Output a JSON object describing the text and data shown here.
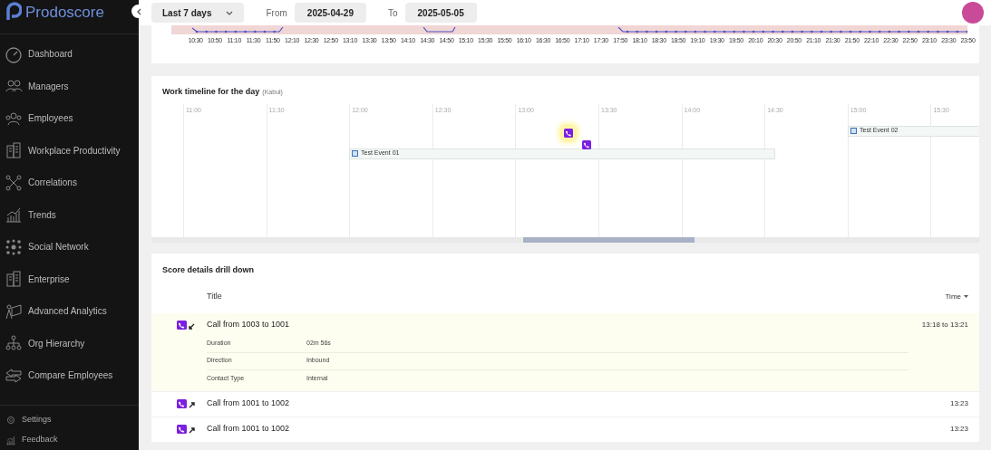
{
  "sidebar": {
    "logo": "Prodoscore",
    "items": [
      {
        "label": "Dashboard"
      },
      {
        "label": "Managers"
      },
      {
        "label": "Employees"
      },
      {
        "label": "Workplace Productivity"
      },
      {
        "label": "Correlations"
      },
      {
        "label": "Trends"
      },
      {
        "label": "Social Network"
      },
      {
        "label": "Enterprise"
      },
      {
        "label": "Advanced Analytics"
      },
      {
        "label": "Org Hierarchy"
      },
      {
        "label": "Compare Employees"
      }
    ],
    "footer": [
      {
        "label": "Settings"
      },
      {
        "label": "Feedback"
      }
    ]
  },
  "toolbar": {
    "range": "Last 7 days",
    "from_label": "From",
    "from": "2025-04-29",
    "to_label": "To",
    "to": "2025-05-05"
  },
  "activity_strip": {
    "labels": [
      "10:30",
      "10:50",
      "11:10",
      "11:30",
      "11:50",
      "12:10",
      "12:30",
      "12:50",
      "13:10",
      "13:30",
      "13:50",
      "14:10",
      "14:30",
      "14:50",
      "15:10",
      "15:30",
      "15:50",
      "16:10",
      "16:30",
      "16:50",
      "17:10",
      "17:30",
      "17:50",
      "18:10",
      "18:30",
      "18:50",
      "19:10",
      "19:30",
      "19:50",
      "20:10",
      "20:30",
      "20:50",
      "21:10",
      "21:30",
      "21:50",
      "22:10",
      "22:30",
      "22:50",
      "23:10",
      "23:30",
      "23:50"
    ]
  },
  "timeline": {
    "title": "Work timeline for the day",
    "timezone": "(Kabul)",
    "hours": [
      "11:00",
      "11:30",
      "12:00",
      "12:30",
      "13:00",
      "13:30",
      "14:00",
      "14:30",
      "15:00",
      "15:30"
    ],
    "events": [
      {
        "label": "Test Event 02"
      },
      {
        "label": "Test Event 01"
      }
    ],
    "calls": [
      {
        "selected": true
      },
      {
        "selected": false
      }
    ]
  },
  "drilldown": {
    "title": "Score details drill down",
    "columns": [
      "Title",
      "Time"
    ],
    "rows": [
      {
        "title": "Call from 1003 to 1001",
        "time": "13:18 to 13:21",
        "kind": "inbound",
        "expanded": true,
        "details": [
          {
            "label": "Duration",
            "value": "02m 56s"
          },
          {
            "label": "Direction",
            "value": "Inbound"
          },
          {
            "label": "Contact Type",
            "value": "Internal"
          }
        ]
      },
      {
        "title": "Call from 1001 to 1002",
        "time": "13:23",
        "kind": "outbound",
        "expanded": false
      },
      {
        "title": "Call from 1001 to 1002",
        "time": "13:23",
        "kind": "outbound",
        "expanded": false
      }
    ]
  }
}
